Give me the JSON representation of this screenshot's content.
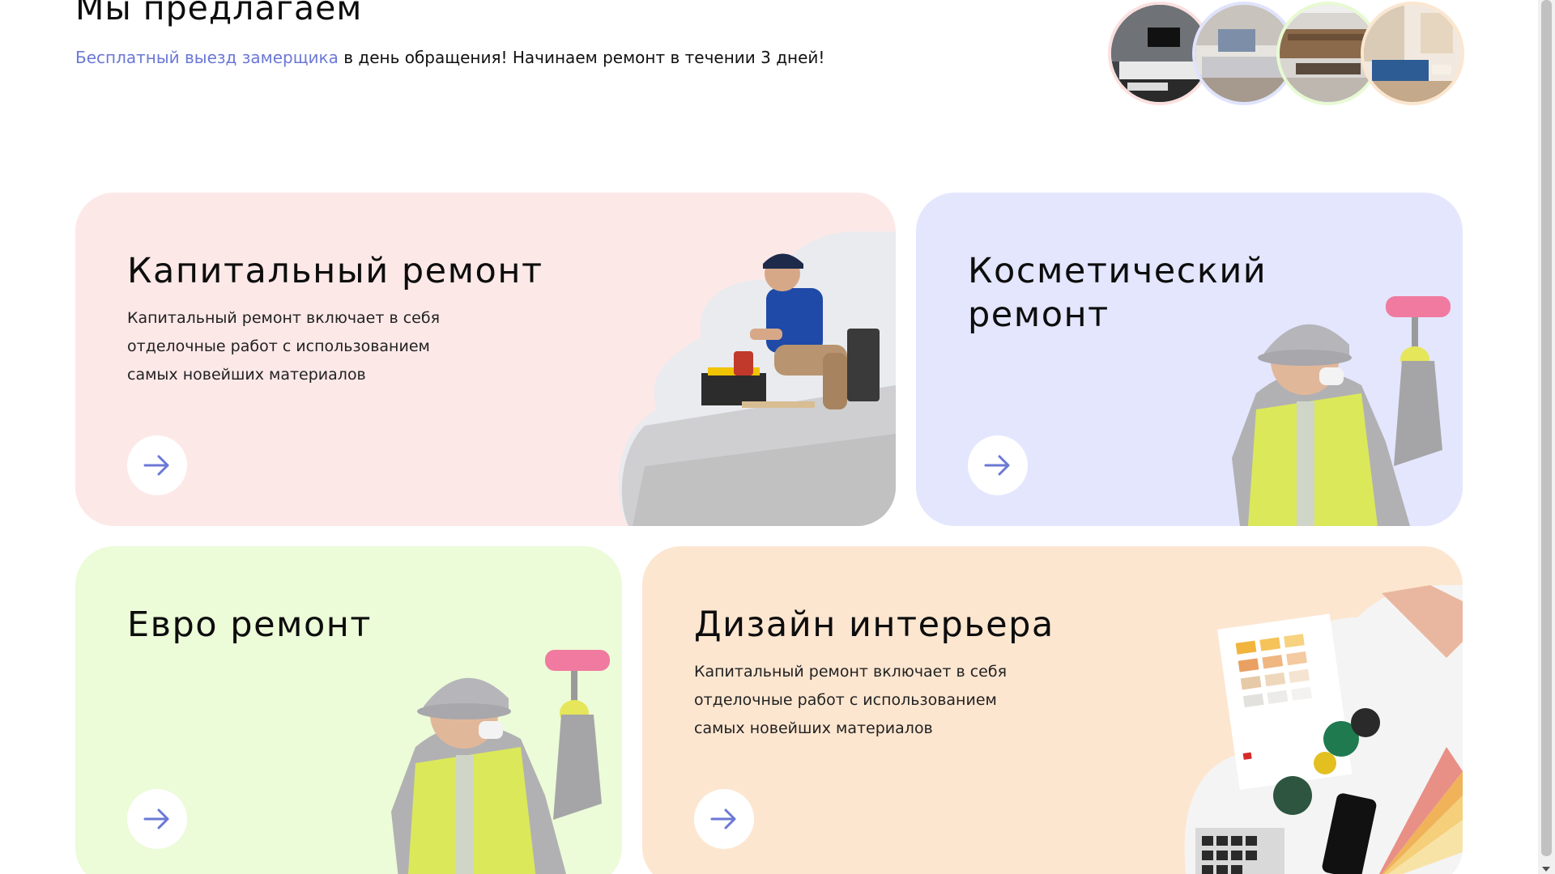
{
  "header": {
    "title": "Мы предлагаем",
    "subtitle_link": "Бесплатный выезд замерщика",
    "subtitle_rest": " в день обращения! Начинаем ремонт в течении 3 дней!"
  },
  "gallery": {
    "circles": [
      {
        "name": "interior-photo-1",
        "ring_color": "#fbe0e0"
      },
      {
        "name": "interior-photo-2",
        "ring_color": "#dfe3fc"
      },
      {
        "name": "interior-photo-3",
        "ring_color": "#e7fad3"
      },
      {
        "name": "interior-photo-4",
        "ring_color": "#fbe6d0"
      }
    ]
  },
  "cards": [
    {
      "title": "Капитальный ремонт",
      "description": "Капитальный ремонт включает в себя отделочные работ с использованием самых новейших материалов",
      "background": "#fde8e8",
      "image": "worker-with-drill-photo"
    },
    {
      "title": "Косметический ремонт",
      "description": "",
      "background": "#e3e6fd",
      "image": "painter-with-roller-photo"
    },
    {
      "title": "Евро ремонт",
      "description": "",
      "background": "#ecfbd8",
      "image": "painter-with-roller-photo"
    },
    {
      "title": "Дизайн интерьера",
      "description": "Капитальный ремонт включает в себя отделочные работ с использованием самых новейших материалов",
      "background": "#fde6d0",
      "image": "color-swatches-photo"
    }
  ],
  "colors": {
    "accent": "#6b78d6",
    "arrow": "#6b78d6"
  },
  "icons": {
    "card_button": "arrow-right-icon"
  }
}
